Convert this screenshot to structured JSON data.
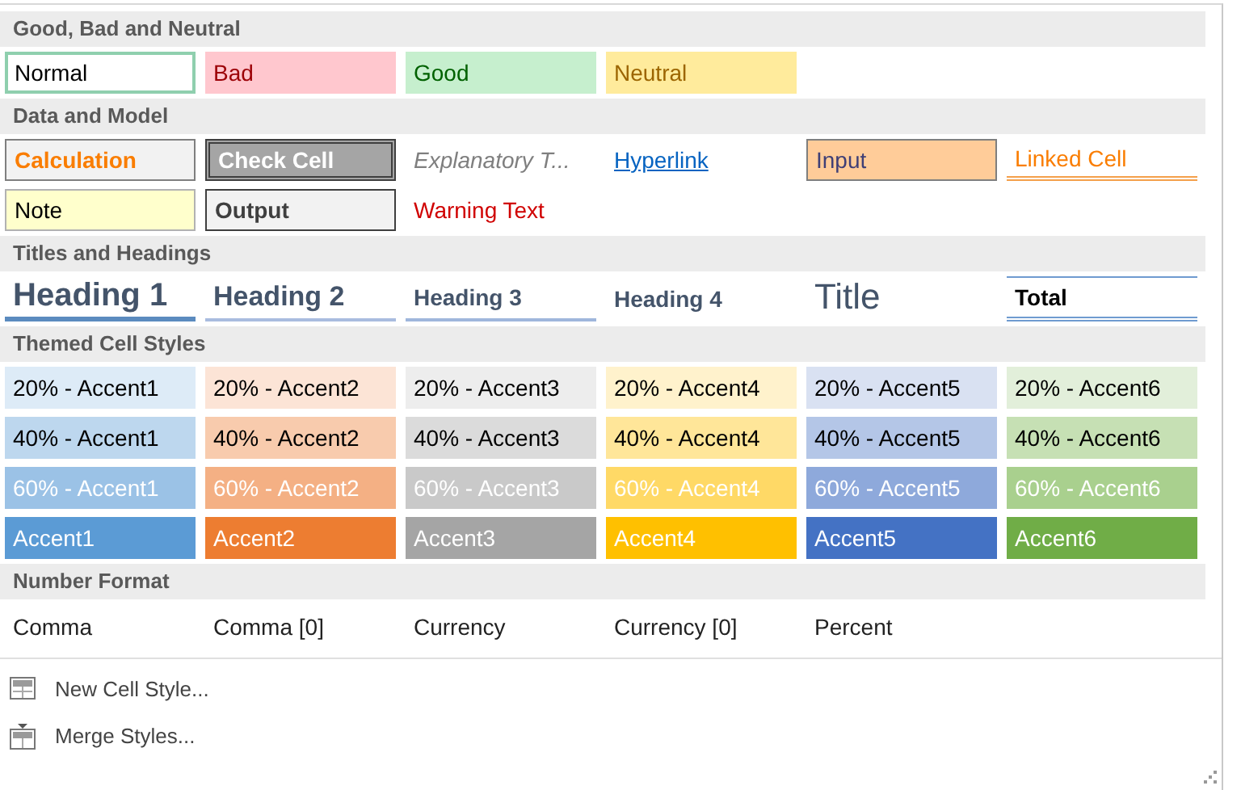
{
  "sections": [
    {
      "title": "Good, Bad and Neutral",
      "rows": [
        [
          {
            "label": "Normal",
            "kind": "normal",
            "selected": true
          },
          {
            "label": "Bad",
            "kind": "bad",
            "selected": false
          },
          {
            "label": "Good",
            "kind": "good",
            "selected": false
          },
          {
            "label": "Neutral",
            "kind": "neutral",
            "selected": false
          }
        ]
      ]
    },
    {
      "title": "Data and Model",
      "rows": [
        [
          {
            "label": "Calculation",
            "kind": "calculation",
            "selected": false
          },
          {
            "label": "Check Cell",
            "kind": "check",
            "selected": false
          },
          {
            "label": "Explanatory T...",
            "kind": "explanatory",
            "selected": false
          },
          {
            "label": "Hyperlink",
            "kind": "hyperlink",
            "selected": false
          },
          {
            "label": "Input",
            "kind": "input",
            "selected": false
          },
          {
            "label": "Linked Cell",
            "kind": "linked",
            "selected": false
          }
        ],
        [
          {
            "label": "Note",
            "kind": "note",
            "selected": false
          },
          {
            "label": "Output",
            "kind": "output",
            "selected": false
          },
          {
            "label": "Warning Text",
            "kind": "warning",
            "selected": false
          }
        ]
      ]
    },
    {
      "title": "Titles and Headings",
      "rows": [
        [
          {
            "label": "Heading 1",
            "kind": "heading1",
            "selected": false
          },
          {
            "label": "Heading 2",
            "kind": "heading2",
            "selected": false
          },
          {
            "label": "Heading 3",
            "kind": "heading3",
            "selected": false
          },
          {
            "label": "Heading 4",
            "kind": "heading4",
            "selected": false
          },
          {
            "label": "Title",
            "kind": "title",
            "selected": false
          },
          {
            "label": "Total",
            "kind": "total",
            "selected": false
          }
        ]
      ]
    },
    {
      "title": "Themed Cell Styles",
      "rows": [
        [
          {
            "label": "20% - Accent1",
            "kind": "tint",
            "color": "#ddebf7",
            "selected": false
          },
          {
            "label": "20% - Accent2",
            "kind": "tint",
            "color": "#fce4d6",
            "selected": false
          },
          {
            "label": "20% - Accent3",
            "kind": "tint",
            "color": "#ededed",
            "selected": false
          },
          {
            "label": "20% - Accent4",
            "kind": "tint",
            "color": "#fff2cc",
            "selected": false
          },
          {
            "label": "20% - Accent5",
            "kind": "tint",
            "color": "#d9e1f2",
            "selected": false
          },
          {
            "label": "20% - Accent6",
            "kind": "tint",
            "color": "#e2efda",
            "selected": false
          }
        ],
        [
          {
            "label": "40% - Accent1",
            "kind": "tint",
            "color": "#bdd7ee",
            "selected": false
          },
          {
            "label": "40% - Accent2",
            "kind": "tint",
            "color": "#f8cbad",
            "selected": false
          },
          {
            "label": "40% - Accent3",
            "kind": "tint",
            "color": "#dbdbdb",
            "selected": false
          },
          {
            "label": "40% - Accent4",
            "kind": "tint",
            "color": "#ffe699",
            "selected": false
          },
          {
            "label": "40% - Accent5",
            "kind": "tint",
            "color": "#b4c6e7",
            "selected": false
          },
          {
            "label": "40% - Accent6",
            "kind": "tint",
            "color": "#c6e0b4",
            "selected": false
          }
        ],
        [
          {
            "label": "60% - Accent1",
            "kind": "shade",
            "color": "#9bc2e6",
            "selected": false
          },
          {
            "label": "60% - Accent2",
            "kind": "shade",
            "color": "#f4b084",
            "selected": false
          },
          {
            "label": "60% - Accent3",
            "kind": "shade",
            "color": "#c9c9c9",
            "selected": false
          },
          {
            "label": "60% - Accent4",
            "kind": "shade",
            "color": "#ffd966",
            "selected": false
          },
          {
            "label": "60% - Accent5",
            "kind": "shade",
            "color": "#8ea9db",
            "selected": false
          },
          {
            "label": "60% - Accent6",
            "kind": "shade",
            "color": "#a9d08e",
            "selected": false
          }
        ],
        [
          {
            "label": "Accent1",
            "kind": "shade",
            "color": "#5b9bd5",
            "selected": false
          },
          {
            "label": "Accent2",
            "kind": "shade",
            "color": "#ed7d31",
            "selected": false
          },
          {
            "label": "Accent3",
            "kind": "shade",
            "color": "#a5a5a5",
            "selected": false
          },
          {
            "label": "Accent4",
            "kind": "shade",
            "color": "#ffc000",
            "selected": false
          },
          {
            "label": "Accent5",
            "kind": "shade",
            "color": "#4472c4",
            "selected": false
          },
          {
            "label": "Accent6",
            "kind": "shade",
            "color": "#70ad47",
            "selected": false
          }
        ]
      ]
    },
    {
      "title": "Number Format",
      "rows": [
        [
          {
            "label": "Comma",
            "kind": "plain",
            "selected": false
          },
          {
            "label": "Comma [0]",
            "kind": "plain",
            "selected": false
          },
          {
            "label": "Currency",
            "kind": "plain",
            "selected": false
          },
          {
            "label": "Currency [0]",
            "kind": "plain",
            "selected": false
          },
          {
            "label": "Percent",
            "kind": "plain",
            "selected": false
          }
        ]
      ]
    }
  ],
  "menu": [
    {
      "label": "New Cell Style...",
      "kind": "new"
    },
    {
      "label": "Merge Styles...",
      "kind": "merge"
    }
  ]
}
